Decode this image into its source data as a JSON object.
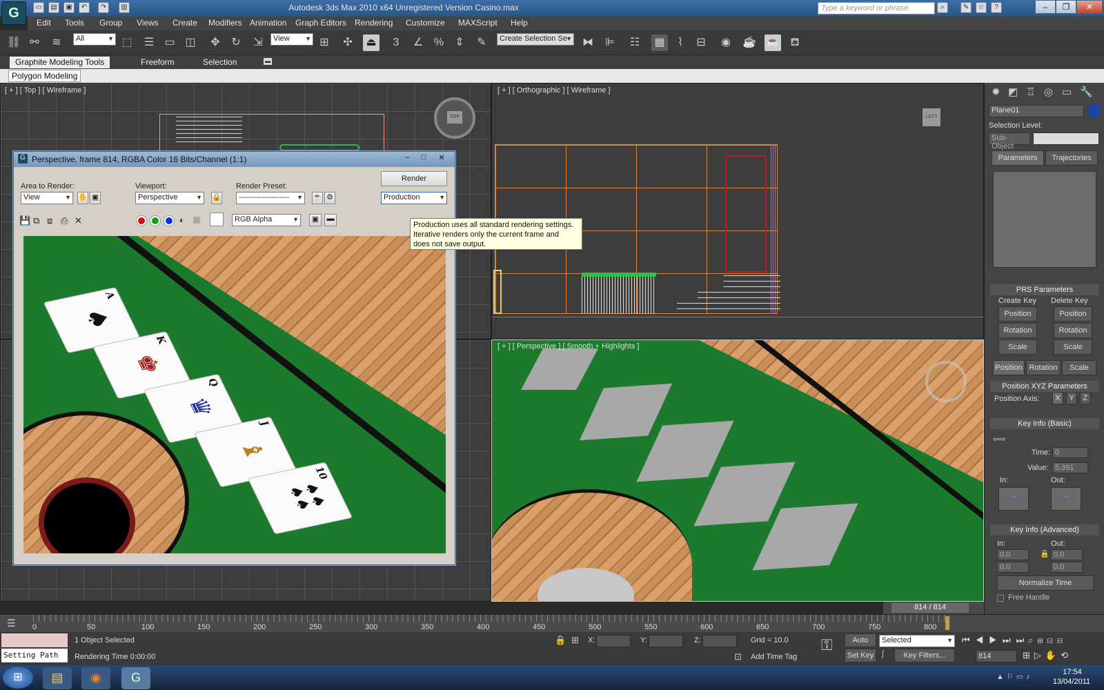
{
  "window": {
    "title": "Autodesk 3ds Max  2010 x64    Unregistered Version       Casino.max",
    "search_placeholder": "Type a keyword or phrase"
  },
  "menu": [
    "Edit",
    "Tools",
    "Group",
    "Views",
    "Create",
    "Modifiers",
    "Animation",
    "Graph Editors",
    "Rendering",
    "Customize",
    "MAXScript",
    "Help"
  ],
  "toolbar": {
    "filter": "All",
    "ref_coord": "View",
    "selection_set": "Create Selection Se"
  },
  "ribbon": {
    "tabs": [
      "Graphite Modeling Tools",
      "Freeform",
      "Selection"
    ],
    "sub": "Polygon Modeling"
  },
  "viewports": {
    "top": "[ + ] [ Top ] [ Wireframe ]",
    "ortho": "[ + ] [ Orthographic ] [ Wireframe ]",
    "persp": "[ + ] [ Perspective ] [ Smooth + Highlights ]",
    "viewcube_top": "TOP",
    "viewcube_left": "LEFT"
  },
  "render_dialog": {
    "title": "Perspective, frame 814, RGBA Color 16 Bits/Channel (1:1)",
    "area_label": "Area to Render:",
    "area_value": "View",
    "viewport_label": "Viewport:",
    "viewport_value": "Perspective",
    "preset_label": "Render Preset:",
    "preset_value": "--------------------",
    "render_button": "Render",
    "production_value": "Production",
    "channel_value": "RGB Alpha",
    "cards": [
      "A",
      "K",
      "Q",
      "J",
      "10"
    ]
  },
  "tooltip": {
    "line1": "Production uses all standard rendering settings.",
    "line2": "Iterative renders only the current frame and",
    "line3": "does not save output."
  },
  "command_panel": {
    "object_name": "Plane01",
    "selection_level": "Selection Level:",
    "sub_object": "Sub-Object",
    "tabs": [
      "Parameters",
      "Trajectories"
    ],
    "prs_title": "PRS Parameters",
    "create_key": "Create Key",
    "delete_key": "Delete Key",
    "prs_buttons": [
      "Position",
      "Rotation",
      "Scale"
    ],
    "prs_mode": [
      "Position",
      "Rotation",
      "Scale"
    ],
    "xyz_title": "Position XYZ Parameters",
    "position_axis": "Position Axis:",
    "axes": [
      "X",
      "Y",
      "Z"
    ],
    "key_basic_title": "Key Info (Basic)",
    "time_label": "Time:",
    "time_value": "0",
    "value_label": "Value:",
    "value_value": "5.391",
    "in_label": "In:",
    "out_label": "Out:",
    "key_adv_title": "Key Info (Advanced)",
    "adv_in": "In:",
    "adv_out": "Out:",
    "adv_values": [
      "0.0",
      "0.0",
      "0.0",
      "0.0"
    ],
    "normalize": "Normalize Time",
    "free_handle": "Free Handle"
  },
  "timeline": {
    "frame": "814 / 814",
    "ticks": [
      "0",
      "50",
      "100",
      "150",
      "200",
      "250",
      "300",
      "350",
      "400",
      "450",
      "500",
      "550",
      "600",
      "650",
      "700",
      "750",
      "800"
    ]
  },
  "status": {
    "path": "Setting Path",
    "selected": "1 Object Selected",
    "render_time": "Rendering Time  0:00:00",
    "x_label": "X:",
    "y_label": "Y:",
    "z_label": "Z:",
    "grid": "Grid = 10.0",
    "add_time_tag": "Add Time Tag",
    "auto_key": "Auto Key",
    "set_key": "Set Key",
    "selected_combo": "Selected",
    "key_filters": "Key Filters...",
    "frame_field": "814"
  },
  "taskbar": {
    "time": "17:54",
    "date": "13/04/2011"
  }
}
